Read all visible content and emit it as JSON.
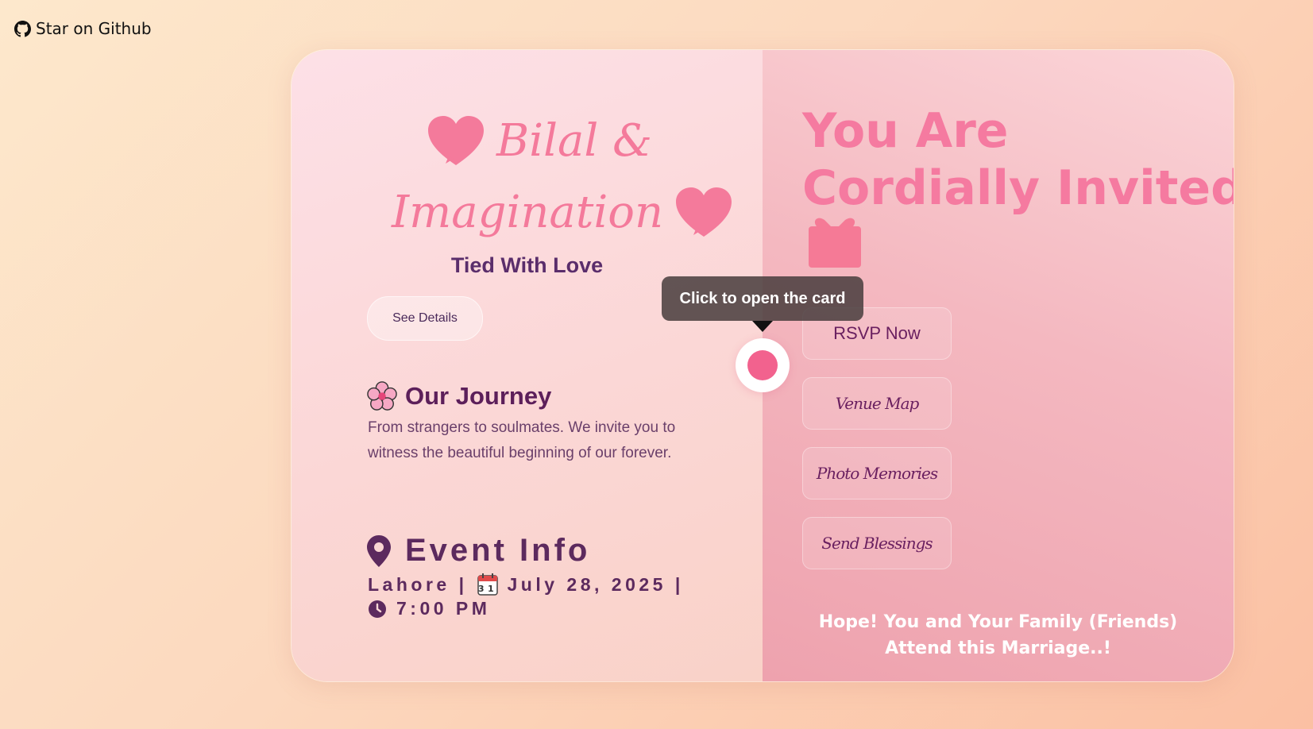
{
  "github": {
    "label": "Star on Github",
    "icon": "github-icon"
  },
  "card": {
    "left": {
      "title_line1": "Bilal &",
      "title_line2": "Imagination",
      "subtitle": "Tied With Love",
      "see_details": "See Details",
      "journey": {
        "icon": "cherry-blossom-icon",
        "title": "Our Journey",
        "text": "From strangers to soulmates. We invite you to witness the beautiful beginning of our forever."
      },
      "event": {
        "title": "Event Info",
        "location": "Lahore |",
        "date": "July 28, 2025 |",
        "time": "7:00 PM"
      }
    },
    "right": {
      "heading_line1": "You Are",
      "heading_line2": "Cordially Invited",
      "buttons": {
        "rsvp": "RSVP Now",
        "venue": "Venue Map",
        "photos": "Photo Memories",
        "blessings": "Send Blessings"
      },
      "footer_line1": "Hope! You and Your Family (Friends)",
      "footer_line2": "Attend this Marriage..!"
    },
    "tooltip": "Click to open the card"
  },
  "colors": {
    "accent_pink": "#f47a9b",
    "deep_purple": "#5c2a5e",
    "dot_pink": "#f2628e"
  }
}
